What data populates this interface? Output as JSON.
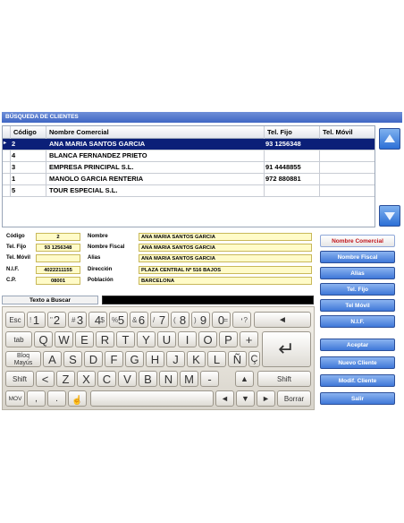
{
  "window": {
    "title": "BÚSQUEDA DE CLIENTES"
  },
  "grid": {
    "columns": [
      "Código",
      "Nombre Comercial",
      "Tel. Fijo",
      "Tel. Móvil"
    ],
    "rows": [
      {
        "codigo": "2",
        "nombre": "ANA MARIA SANTOS GARCIA",
        "fijo": "93 1256348",
        "movil": ""
      },
      {
        "codigo": "4",
        "nombre": "BLANCA FERNANDEZ PRIETO",
        "fijo": "",
        "movil": ""
      },
      {
        "codigo": "3",
        "nombre": "EMPRESA PRINCIPAL S.L.",
        "fijo": "91 4448855",
        "movil": ""
      },
      {
        "codigo": "1",
        "nombre": "MANOLO GARCIA RENTERIA",
        "fijo": "972 880881",
        "movil": ""
      },
      {
        "codigo": "5",
        "nombre": "TOUR ESPECIAL S.L.",
        "fijo": "",
        "movil": ""
      }
    ],
    "row_indicator": "▸"
  },
  "detail": {
    "codigo_label": "Código",
    "codigo": "2",
    "telfijo_label": "Tel. Fijo",
    "telfijo": "93 1256348",
    "telmovil_label": "Tel. Móvil",
    "telmovil": "",
    "nif_label": "N.I.F.",
    "nif": "4022211155",
    "cp_label": "C.P.",
    "cp": "08001",
    "nombre_label": "Nombre",
    "nombre": "ANA MARIA SANTOS GARCIA",
    "fiscal_label": "Nombre Fiscal",
    "fiscal": "ANA MARIA SANTOS GARCIA",
    "alias_label": "Alias",
    "alias": "ANA MARIA SANTOS GARCIA",
    "direccion_label": "Dirección",
    "direccion": "PLAZA CENTRAL Nº 516 BAJOS",
    "poblacion_label": "Población",
    "poblacion": "BARCELONA"
  },
  "search": {
    "label": "Texto a Buscar",
    "value": ""
  },
  "keyboard": {
    "esc": "Esc",
    "tab": "tab",
    "bloq": "Bloq",
    "mayus": "Mayús",
    "shift": "Shift",
    "mov": "MOV",
    "borrar": "Borrar",
    "row1": [
      [
        "1",
        "!"
      ],
      [
        "2",
        "\""
      ],
      [
        "3",
        "#"
      ],
      [
        "4",
        "$"
      ],
      [
        "5",
        "%"
      ],
      [
        "6",
        "&"
      ],
      [
        "7",
        "/"
      ],
      [
        "8",
        "("
      ],
      [
        "9",
        ")"
      ],
      [
        "0",
        "="
      ],
      [
        "'",
        "?"
      ]
    ],
    "row2": [
      "Q",
      "W",
      "E",
      "R",
      "T",
      "Y",
      "U",
      "I",
      "O",
      "P",
      "+"
    ],
    "row3": [
      "A",
      "S",
      "D",
      "F",
      "G",
      "H",
      "J",
      "K",
      "L",
      "Ñ",
      "Ç"
    ],
    "row4": [
      "<",
      "Z",
      "X",
      "C",
      "V",
      "B",
      "N",
      "M",
      "-"
    ],
    "row5": [
      ",",
      "."
    ],
    "backspace": "◄",
    "up": "▲",
    "left": "◄",
    "down": "▼",
    "right": "►",
    "enter": "↵"
  },
  "sidebar": {
    "nombre_comercial": "Nombre Comercial",
    "nombre_fiscal": "Nombre Fiscal",
    "alias": "Alias",
    "tel_fijo": "Tel. Fijo",
    "tel_movil": "Tel Móvil",
    "nif": "N.I.F.",
    "aceptar": "Aceptar",
    "nuevo_cliente": "Nuevo Cliente",
    "modif_cliente": "Modif. Cliente",
    "salir": "Salir"
  }
}
